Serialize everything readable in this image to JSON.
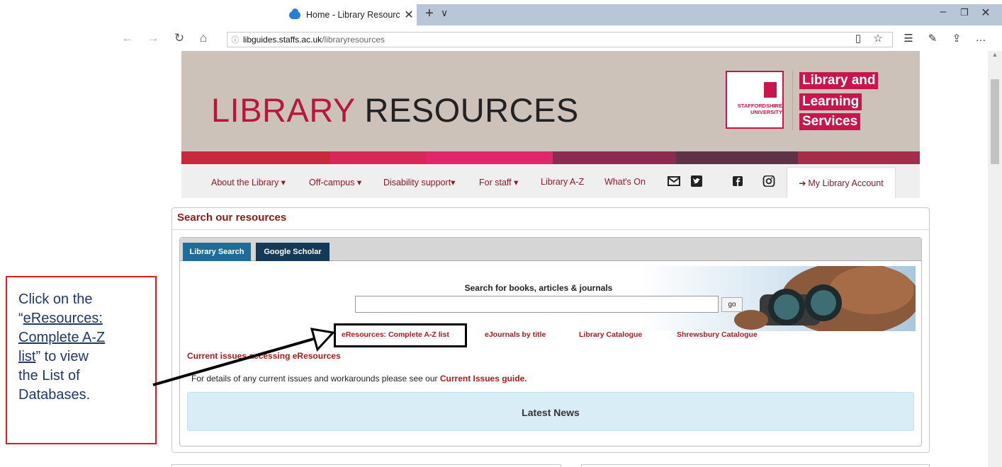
{
  "browser": {
    "tab_title": "Home - Library Resourc",
    "tab_close": "✕",
    "new_tab": "+",
    "tab_menu": "∨",
    "minimize": "–",
    "restore": "❐",
    "close": "✕",
    "url_host": "libguides.staffs.ac.uk",
    "url_path": "/libraryresources",
    "nav": {
      "back": "←",
      "forward": "→",
      "refresh": "↻",
      "home": "⌂"
    },
    "toolbar": {
      "reading_view": "▯",
      "favorite": "☆",
      "favorites_hub": "☰",
      "pen": "✎",
      "share": "⇪",
      "more": "…"
    }
  },
  "banner": {
    "title_part1": "LIBRARY",
    "title_part2": "RESOURCES",
    "logo_text": "STAFFORDSHIRE\nUNIVERSITY",
    "lls_lines": [
      "Library and",
      "Learning",
      "Services"
    ],
    "strip_colors": [
      "#c62a3c",
      "#d8285a",
      "#e0276b",
      "#8c2a4f",
      "#5e3247",
      "#a52d4c"
    ]
  },
  "nav": {
    "items": [
      "About the Library ▾",
      "Off-campus ▾",
      "Disability support▾",
      "For staff ▾",
      "Library A-Z",
      "What's On"
    ],
    "icons": [
      "email-icon",
      "twitter-icon",
      "facebook-icon",
      "instagram-icon"
    ],
    "account_label": "My Library Account",
    "account_icon": "➔"
  },
  "search_panel": {
    "heading": "Search our resources",
    "tabs": [
      "Library Search",
      "Google Scholar"
    ],
    "search_label": "Search for books, articles & journals",
    "search_value": "",
    "go_label": "go",
    "quick_links": [
      "eResources: Complete A-Z list",
      "eJournals by title",
      "Library Catalogue",
      "Shrewsbury Catalogue"
    ],
    "issues_heading": "Current issues accessing eResources",
    "issues_text": "For details of any current issues and workarounds please see our",
    "issues_link": "Current Issues guide.",
    "news_label": "Latest News"
  },
  "annotation": {
    "line1": "Click on the",
    "quote_open": "“",
    "link_line1": "eResources:",
    "link_line2": "Complete A-Z",
    "link_line3": "list",
    "after_link": "” to view",
    "line_rest1": "the List of",
    "line_rest2": "Databases."
  },
  "colors": {
    "brand_red": "#b5183b",
    "link_red": "#a51d1d",
    "tab_blue": "#1f6d96",
    "tab_navy": "#143a57",
    "annotation_red": "#e01b1b",
    "annotation_text": "#1f3864"
  }
}
